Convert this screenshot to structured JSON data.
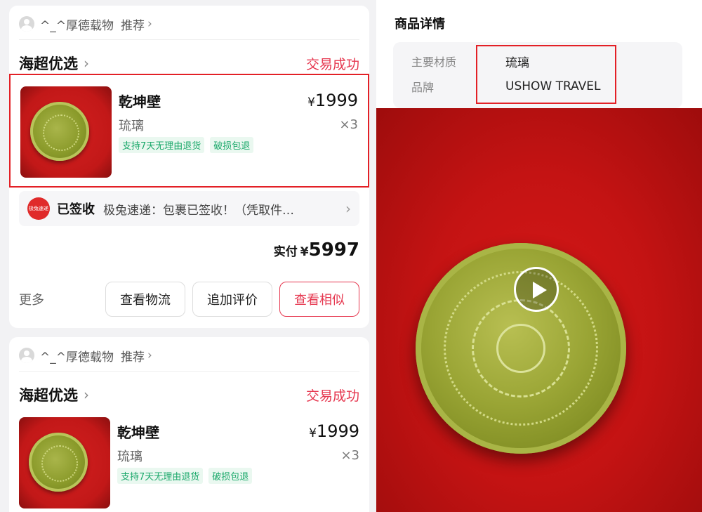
{
  "orders": [
    {
      "shop_owner": "^_^厚德载物",
      "recommend_label": "推荐",
      "store_name": "海超优选",
      "status": "交易成功",
      "product": {
        "name": "乾坤壁",
        "material": "琉璃",
        "price": "1999",
        "currency": "¥",
        "quantity": "×3",
        "tags": [
          "支持7天无理由退货",
          "破损包退"
        ]
      },
      "logistics": {
        "courier_badge": "极兔速递",
        "state": "已签收",
        "text": "极兔速递：包裹已签收！（凭取件…"
      },
      "paid_label": "实付",
      "paid_currency": "¥",
      "paid_amount": "5997",
      "more_label": "更多",
      "buttons": [
        "查看物流",
        "追加评价",
        "查看相似"
      ]
    },
    {
      "shop_owner": "^_^厚德载物",
      "recommend_label": "推荐",
      "store_name": "海超优选",
      "status": "交易成功",
      "product": {
        "name": "乾坤壁",
        "material": "琉璃",
        "price": "1999",
        "currency": "¥",
        "quantity": "×3",
        "tags": [
          "支持7天无理由退货",
          "破损包退"
        ]
      }
    }
  ],
  "detail": {
    "title": "商品详情",
    "attributes": [
      {
        "key": "主要材质",
        "value": "琉璃"
      },
      {
        "key": "品牌",
        "value": "USHOW TRAVEL"
      }
    ]
  },
  "colors": {
    "accent": "#e6374f",
    "highlight_box": "#e32026",
    "tag_green": "#1aa86a"
  },
  "icons": {
    "avatar": "user-avatar-icon",
    "chevron": "chevron-right-icon",
    "play": "play-icon"
  }
}
